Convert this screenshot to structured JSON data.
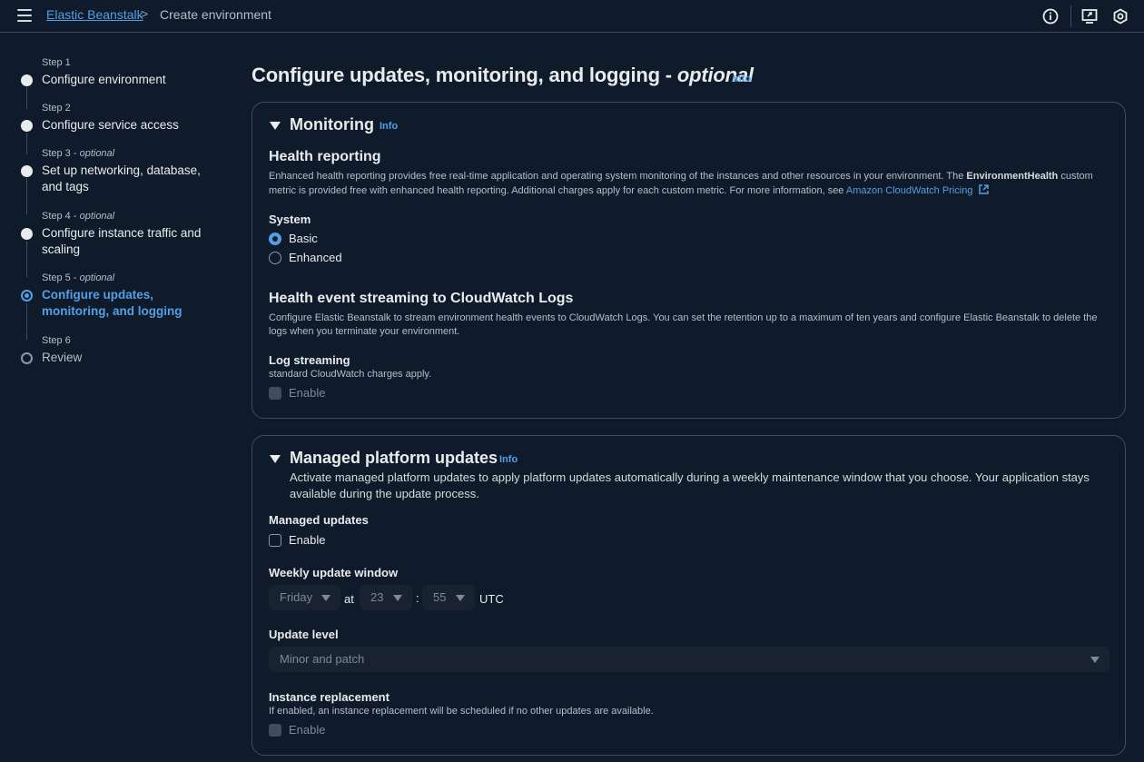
{
  "topbar": {
    "breadcrumb_root": "Elastic Beanstalk",
    "breadcrumb_sep": ">",
    "breadcrumb_current": "Create environment"
  },
  "steps": [
    {
      "small": "Step 1",
      "optional": "",
      "title": "Configure environment"
    },
    {
      "small": "Step 2",
      "optional": "",
      "title": "Configure service access"
    },
    {
      "small": "Step 3 - ",
      "optional": "optional",
      "title": "Set up networking, database, and tags"
    },
    {
      "small": "Step 4 - ",
      "optional": "optional",
      "title": "Configure instance traffic and scaling"
    },
    {
      "small": "Step 5 - ",
      "optional": "optional",
      "title": "Configure updates, monitoring, and logging"
    },
    {
      "small": "Step 6",
      "optional": "",
      "title": "Review"
    }
  ],
  "page": {
    "title": "Configure updates, monitoring, and logging - ",
    "title_optional": "optional",
    "info": "Info"
  },
  "monitoring": {
    "title": "Monitoring",
    "info": "Info",
    "health_reporting": "Health reporting",
    "health_desc_1": "Enhanced health reporting provides free real-time application and operating system monitoring of the instances and other resources in your environment. The ",
    "health_desc_bold": "EnvironmentHealth",
    "health_desc_2": " custom",
    "health_desc_3": "metric is provided free with enhanced health reporting. Additional charges apply for each custom metric. For more information, see ",
    "pricing_link": "Amazon CloudWatch Pricing",
    "system_label": "System",
    "system_options": [
      "Basic",
      "Enhanced"
    ],
    "system_selected": "Basic",
    "streaming_title": "Health event streaming to CloudWatch Logs",
    "streaming_desc_1": "Configure Elastic Beanstalk to stream environment health events to CloudWatch Logs. You can set the retention up to a maximum of ten years and configure Elastic Beanstalk to delete the",
    "streaming_desc_2": "logs when you terminate your environment.",
    "log_streaming_label": "Log streaming",
    "log_streaming_desc": "standard CloudWatch charges apply.",
    "log_streaming_enable": "Enable"
  },
  "managed": {
    "title": "Managed platform updates",
    "info": "Info",
    "desc_1": "Activate managed platform updates to apply platform updates automatically during a weekly maintenance window that you choose. Your application stays",
    "desc_2": "available during the update process.",
    "managed_updates_label": "Managed updates",
    "managed_updates_enable": "Enable",
    "window_label": "Weekly update window",
    "day": "Friday",
    "at": "at",
    "hour": "23",
    "colon": ":",
    "minute": "55",
    "tz": "UTC",
    "level_label": "Update level",
    "level_value": "Minor and patch",
    "replacement_label": "Instance replacement",
    "replacement_desc": "If enabled, an instance replacement will be scheduled if no other updates are available.",
    "replacement_enable": "Enable"
  }
}
